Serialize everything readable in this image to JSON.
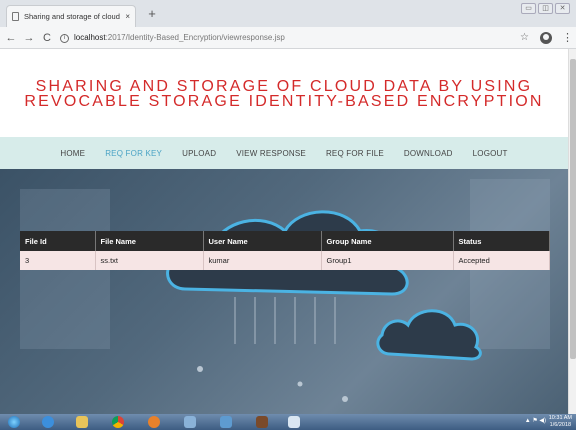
{
  "browser": {
    "tab_title": "Sharing and storage of cloud da",
    "tab_close": "×",
    "new_tab": "+",
    "window_controls": [
      "▭",
      "◫",
      "✕"
    ],
    "back": "←",
    "forward": "→",
    "reload": "C",
    "url_host": "localhost",
    "url_path": ":2017/Identity-Based_Encryption/viewresponse.jsp",
    "star": "☆",
    "menu": "⋮"
  },
  "site": {
    "title_line1": "SHARING AND STORAGE OF CLOUD DATA BY USING",
    "title_line2": "REVOCABLE STORAGE IDENTITY-BASED ENCRYPTION",
    "title_color": "#d42a2a",
    "nav": [
      {
        "label": "HOME",
        "active": false
      },
      {
        "label": "REQ FOR KEY",
        "active": true
      },
      {
        "label": "UPLOAD",
        "active": false
      },
      {
        "label": "VIEW RESPONSE",
        "active": false
      },
      {
        "label": "REQ FOR FILE",
        "active": false
      },
      {
        "label": "DOWNLOAD",
        "active": false
      },
      {
        "label": "LOGOUT",
        "active": false
      }
    ]
  },
  "table": {
    "headers": [
      "File Id",
      "File Name",
      "User Name",
      "Group Name",
      "Status"
    ],
    "rows": [
      [
        "3",
        "ss.txt",
        "kumar",
        "Group1",
        "Accepted"
      ]
    ]
  },
  "taskbar": {
    "clock_time": "10:31 AM",
    "clock_date": "1/6/2018"
  }
}
